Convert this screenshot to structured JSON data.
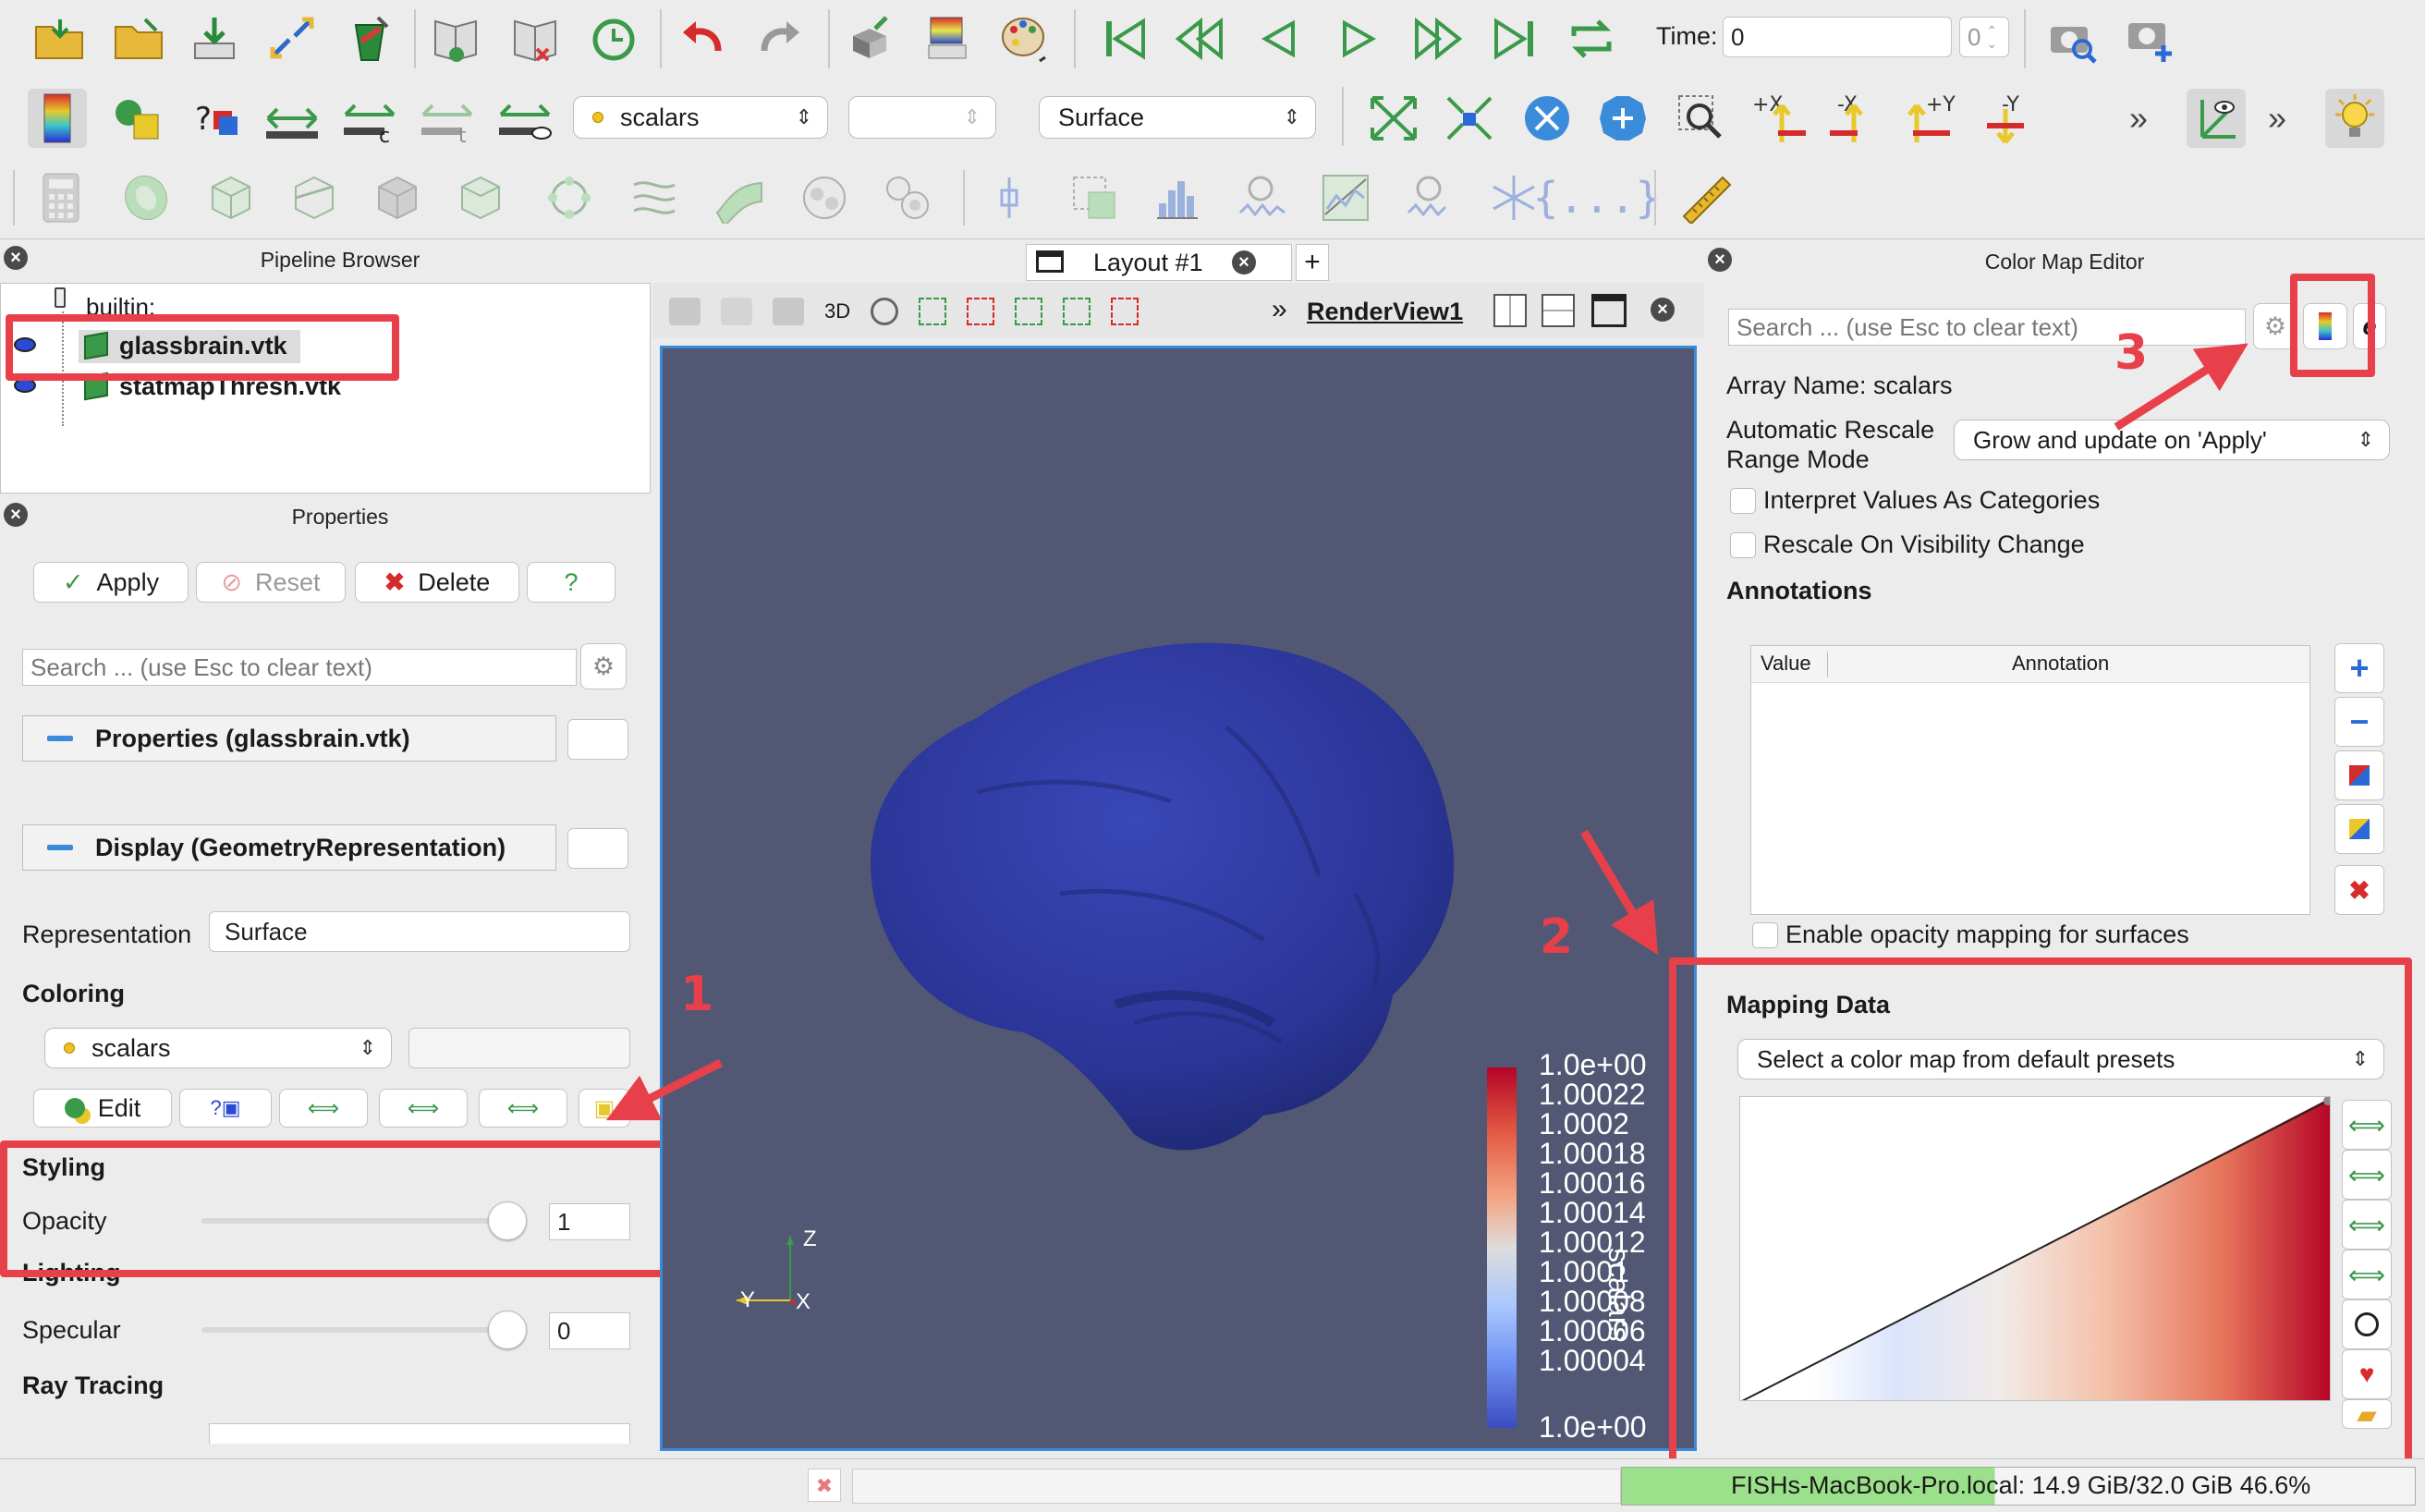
{
  "toolbar": {
    "time_label": "Time:",
    "time_value": "0",
    "time_spin": "0",
    "scalars_combo": "scalars",
    "representation_combo": "Surface"
  },
  "pipeline_browser": {
    "title": "Pipeline Browser",
    "root": "builtin:",
    "items": [
      "glassbrain.vtk",
      "statmapThresh.vtk"
    ]
  },
  "properties": {
    "title": "Properties",
    "apply": "Apply",
    "reset": "Reset",
    "delete": "Delete",
    "help": "?",
    "search_placeholder": "Search ... (use Esc to clear text)",
    "section_properties": "Properties (glassbrain.vtk)",
    "section_display": "Display (GeometryRepresentation)",
    "representation_label": "Representation",
    "representation_value": "Surface",
    "coloring_label": "Coloring",
    "coloring_value": "scalars",
    "edit_label": "Edit",
    "styling_label": "Styling",
    "opacity_label": "Opacity",
    "opacity_value": "1",
    "lighting_label": "Lighting",
    "specular_label": "Specular",
    "specular_value": "0",
    "raytracing_label": "Ray Tracing"
  },
  "layout": {
    "tab_label": "Layout #1",
    "add_tab": "+",
    "view_name": "RenderView1",
    "btn_3d": "3D",
    "axes": {
      "z": "Z",
      "y": "Y",
      "x": "X"
    }
  },
  "scalar_bar": {
    "title": "scalars",
    "ticks": [
      "1.0e+00",
      "1.00022",
      "1.0002",
      "1.00018",
      "1.00016",
      "1.00014",
      "1.00012",
      "1.0001",
      "1.00008",
      "1.00006",
      "1.00004",
      "1.0e+00"
    ]
  },
  "color_map_editor": {
    "title": "Color Map Editor",
    "search_placeholder": "Search ... (use Esc to clear text)",
    "array_name": "Array Name: scalars",
    "rescale_label_1": "Automatic Rescale",
    "rescale_label_2": "Range Mode",
    "rescale_value": "Grow and update on 'Apply'",
    "interpret_categories": "Interpret Values As Categories",
    "rescale_visibility": "Rescale On Visibility Change",
    "annotations_label": "Annotations",
    "col_value": "Value",
    "col_annotation": "Annotation",
    "enable_opacity": "Enable opacity mapping for surfaces",
    "mapping_data_label": "Mapping Data",
    "preset_value": "Select a color map from default presets"
  },
  "status_bar": {
    "memory": "FISHs-MacBook-Pro.local: 14.9 GiB/32.0 GiB 46.6%"
  },
  "annotations": {
    "n1": "1",
    "n2": "2",
    "n3": "3"
  },
  "colors": {
    "highlight_red": "#e8404a",
    "render_bg": "#525873",
    "brain_blue": "#2f3a9e",
    "accent_blue": "#3a8bd9"
  }
}
